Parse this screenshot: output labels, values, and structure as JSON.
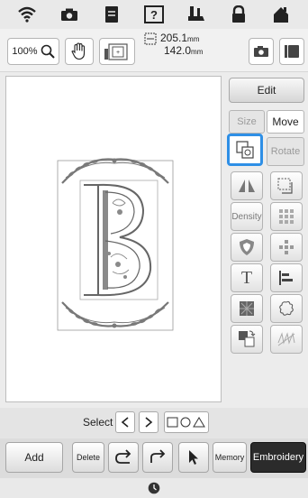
{
  "toolbar": {
    "zoom_label": "100%",
    "width_value": "205.1",
    "height_value": "142.0",
    "unit": "mm"
  },
  "edit_panel": {
    "edit_label": "Edit",
    "tabs": [
      "Size",
      "Move",
      "Rotate"
    ],
    "density_label": "Density",
    "text_icon_label": "T"
  },
  "select_bar": {
    "label": "Select"
  },
  "bottom_bar": {
    "add_label": "Add",
    "delete_label": "Delete",
    "memory_label": "Memory",
    "embroidery_label": "Embroidery"
  },
  "colors": {
    "highlight": "#2e8fe6",
    "dark_button": "#2b2b2b",
    "design_thread": "#6d6d6d"
  }
}
